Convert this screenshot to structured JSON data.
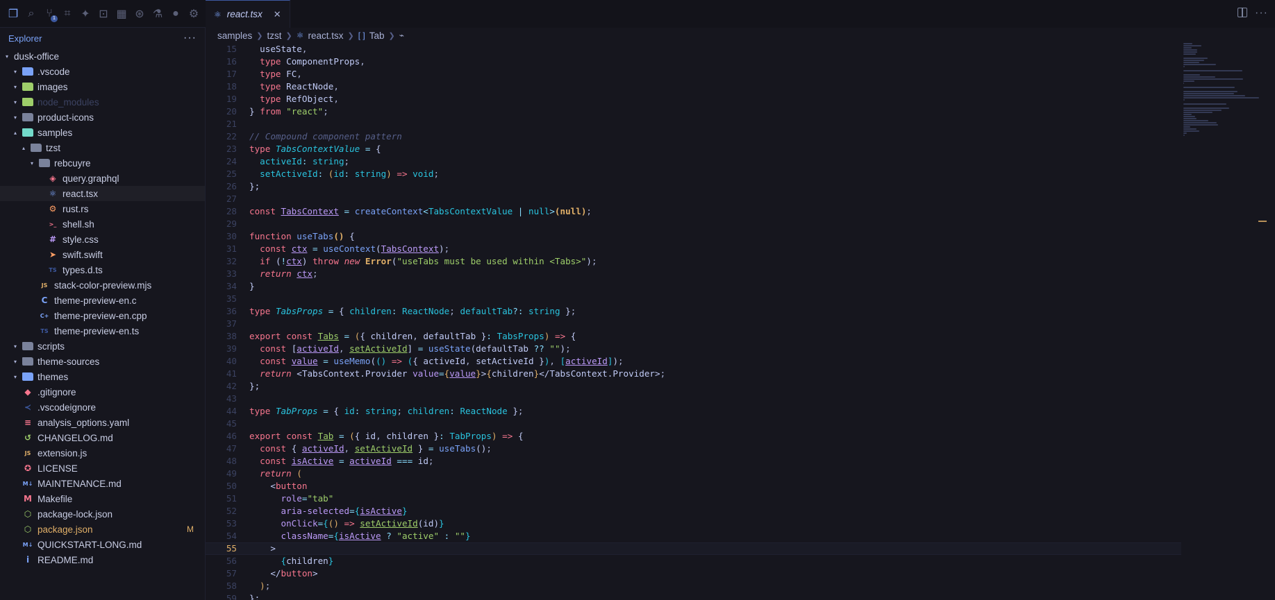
{
  "activity_bar": {
    "icons": [
      {
        "name": "files-icon",
        "glyph": "❐",
        "active": true
      },
      {
        "name": "search-icon",
        "glyph": "⌕"
      },
      {
        "name": "source-control-icon",
        "glyph": "⑂",
        "badge": "1"
      },
      {
        "name": "map-icon",
        "glyph": "⌗"
      },
      {
        "name": "extensions-icon",
        "glyph": "✦"
      },
      {
        "name": "remote-icon",
        "glyph": "⊡"
      },
      {
        "name": "grid-icon",
        "glyph": "▦"
      },
      {
        "name": "palette-icon",
        "glyph": "⊛"
      },
      {
        "name": "flask-icon",
        "glyph": "⚗"
      },
      {
        "name": "circle-icon",
        "glyph": "●"
      },
      {
        "name": "settings-icon",
        "glyph": "⚙"
      }
    ]
  },
  "sidebar": {
    "title": "Explorer",
    "more": "···",
    "root": "dusk-office",
    "items": [
      {
        "label": ".vscode",
        "depth": 1,
        "chev": "▾",
        "icon": "folder-icon",
        "color": "#7aa2f7",
        "glyph": "▰"
      },
      {
        "label": "images",
        "depth": 1,
        "chev": "▾",
        "icon": "folder-icon",
        "color": "#9ece6a",
        "glyph": "▰"
      },
      {
        "label": "node_modules",
        "depth": 1,
        "chev": "▾",
        "icon": "folder-icon",
        "color": "#9ece6a",
        "glyph": "▰",
        "dim": true
      },
      {
        "label": "product-icons",
        "depth": 1,
        "chev": "▾",
        "icon": "folder-icon",
        "color": "#7a829b",
        "glyph": "▰"
      },
      {
        "label": "samples",
        "depth": 1,
        "chev": "▴",
        "icon": "folder-icon",
        "color": "#73daca",
        "glyph": "▰"
      },
      {
        "label": "tzst",
        "depth": 2,
        "chev": "▴",
        "icon": "folder-icon",
        "color": "#7a829b",
        "glyph": "▰"
      },
      {
        "label": "rebcuyre",
        "depth": 3,
        "chev": "▾",
        "icon": "folder-icon",
        "color": "#7a829b",
        "glyph": "▰"
      },
      {
        "label": "query.graphql",
        "depth": 4,
        "icon": "graphql-icon",
        "color": "#f7768e",
        "glyph": "◈"
      },
      {
        "label": "react.tsx",
        "depth": 4,
        "icon": "react-icon",
        "color": "#7aa2f7",
        "glyph": "⚛",
        "selected": true
      },
      {
        "label": "rust.rs",
        "depth": 4,
        "icon": "rust-icon",
        "color": "#ff9e64",
        "glyph": "⚙"
      },
      {
        "label": "shell.sh",
        "depth": 4,
        "icon": "shell-icon",
        "color": "#f7768e",
        "glyph": ">_"
      },
      {
        "label": "style.css",
        "depth": 4,
        "icon": "css-icon",
        "color": "#bb9af7",
        "glyph": "#"
      },
      {
        "label": "swift.swift",
        "depth": 4,
        "icon": "swift-icon",
        "color": "#ff9e64",
        "glyph": "➤"
      },
      {
        "label": "types.d.ts",
        "depth": 4,
        "icon": "typescript-icon",
        "color": "#3d59a1",
        "glyph": "TS"
      },
      {
        "label": "stack-color-preview.mjs",
        "depth": 3,
        "icon": "javascript-icon",
        "color": "#e0af68",
        "glyph": "JS"
      },
      {
        "label": "theme-preview-en.c",
        "depth": 3,
        "icon": "c-icon",
        "color": "#7aa2f7",
        "glyph": "C"
      },
      {
        "label": "theme-preview-en.cpp",
        "depth": 3,
        "icon": "cpp-icon",
        "color": "#7aa2f7",
        "glyph": "C+"
      },
      {
        "label": "theme-preview-en.ts",
        "depth": 3,
        "icon": "typescript-icon",
        "color": "#3d59a1",
        "glyph": "TS"
      },
      {
        "label": "scripts",
        "depth": 1,
        "chev": "▾",
        "icon": "folder-icon",
        "color": "#7a829b",
        "glyph": "▰"
      },
      {
        "label": "theme-sources",
        "depth": 1,
        "chev": "▾",
        "icon": "folder-icon",
        "color": "#7a829b",
        "glyph": "▰"
      },
      {
        "label": "themes",
        "depth": 1,
        "chev": "▾",
        "icon": "folder-icon",
        "color": "#7aa2f7",
        "glyph": "▰"
      },
      {
        "label": ".gitignore",
        "depth": 1,
        "icon": "git-icon",
        "color": "#f7768e",
        "glyph": "◆"
      },
      {
        "label": ".vscodeignore",
        "depth": 1,
        "icon": "vscode-icon",
        "color": "#3d59a1",
        "glyph": "≺"
      },
      {
        "label": "analysis_options.yaml",
        "depth": 1,
        "icon": "yaml-icon",
        "color": "#f7768e",
        "glyph": "≡"
      },
      {
        "label": "CHANGELOG.md",
        "depth": 1,
        "icon": "changelog-icon",
        "color": "#9ece6a",
        "glyph": "↺"
      },
      {
        "label": "extension.js",
        "depth": 1,
        "icon": "javascript-icon",
        "color": "#e0af68",
        "glyph": "JS"
      },
      {
        "label": "LICENSE",
        "depth": 1,
        "icon": "license-icon",
        "color": "#f7768e",
        "glyph": "✪"
      },
      {
        "label": "MAINTENANCE.md",
        "depth": 1,
        "icon": "markdown-icon",
        "color": "#7aa2f7",
        "glyph": "M↓"
      },
      {
        "label": "Makefile",
        "depth": 1,
        "icon": "makefile-icon",
        "color": "#f7768e",
        "glyph": "M"
      },
      {
        "label": "package-lock.json",
        "depth": 1,
        "icon": "npm-icon",
        "color": "#9ece6a",
        "glyph": "⬡"
      },
      {
        "label": "package.json",
        "depth": 1,
        "icon": "npm-icon",
        "color": "#9ece6a",
        "glyph": "⬡",
        "modified": true,
        "deco": "M"
      },
      {
        "label": "QUICKSTART-LONG.md",
        "depth": 1,
        "icon": "markdown-icon",
        "color": "#7aa2f7",
        "glyph": "M↓"
      },
      {
        "label": "README.md",
        "depth": 1,
        "icon": "info-icon",
        "color": "#7aa2f7",
        "glyph": "i"
      }
    ]
  },
  "tabs": [
    {
      "label": "react.tsx",
      "close": "✕"
    }
  ],
  "breadcrumb": [
    "samples",
    "tzst",
    "react.tsx",
    "Tab"
  ],
  "editor": {
    "current_line": 55,
    "lines": [
      {
        "n": 15,
        "html": "  <span class='var'>useState</span>,"
      },
      {
        "n": 16,
        "html": "  <span class='kw2'>type</span> <span class='var'>ComponentProps</span>,"
      },
      {
        "n": 17,
        "html": "  <span class='kw2'>type</span> <span class='var'>FC</span>,"
      },
      {
        "n": 18,
        "html": "  <span class='kw2'>type</span> <span class='var'>ReactNode</span>,"
      },
      {
        "n": 19,
        "html": "  <span class='kw2'>type</span> <span class='var'>RefObject</span>,"
      },
      {
        "n": 20,
        "html": "<span class='var'>}</span> <span class='kw2'>from</span> <span class='str'>\"react\"</span>;"
      },
      {
        "n": 21,
        "html": ""
      },
      {
        "n": 22,
        "html": "<span class='cm'>// Compound component pattern</span>"
      },
      {
        "n": 23,
        "html": "<span class='kw2'>type</span> <span class='ty it'>TabsContextValue</span> <span class='pun'>=</span> <span class='var'>{</span>"
      },
      {
        "n": 24,
        "html": "  <span class='ty'>activeId</span><span class='pun'>:</span> <span class='ty'>string</span>;"
      },
      {
        "n": 25,
        "html": "  <span class='ty'>setActiveId</span><span class='pun'>:</span> <span class='bold' style='font-weight:normal'>(</span><span class='ty'>id</span><span class='pun'>:</span> <span class='ty'>string</span><span class='bold' style='font-weight:normal'>)</span> <span class='kw2'>=&gt;</span> <span class='ty'>void</span>;"
      },
      {
        "n": 26,
        "html": "<span class='var'>};</span>"
      },
      {
        "n": 27,
        "html": ""
      },
      {
        "n": 28,
        "html": "<span class='kw2'>const</span> <span class='ul' style='color:#bb9af7'>TabsContext</span> <span class='pun'>=</span> <span class='fn'>createContext</span><span class='pun'>&lt;</span><span class='ty'>TabsContextValue</span> <span class='pun'>|</span> <span class='ty'>null</span><span class='pun'>&gt;</span><span class='bold'>(null)</span>;"
      },
      {
        "n": 29,
        "html": ""
      },
      {
        "n": 30,
        "html": "<span class='kw2'>function</span> <span class='fn'>useTabs</span><span class='bold'>()</span> <span class='var'>{</span>"
      },
      {
        "n": 31,
        "html": "  <span class='kw2'>const</span> <span class='ul' style='color:#bb9af7'>ctx</span> <span class='pun'>=</span> <span class='fn'>useContext</span><span class='var'>(</span><span class='ul' style='color:#bb9af7'>TabsContext</span><span class='var'>)</span>;"
      },
      {
        "n": 32,
        "html": "  <span class='kw2'>if</span> <span class='var'>(</span><span class='pun'>!</span><span class='ul' style='color:#bb9af7'>ctx</span><span class='var'>)</span> <span class='kw2'>throw</span> <span class='kw2 it'>new</span> <span class='bold'>Error</span><span class='var'>(</span><span class='str'>\"useTabs must be used within &lt;Tabs&gt;\"</span><span class='var'>)</span>;"
      },
      {
        "n": 33,
        "html": "  <span class='kw2 it'>return</span> <span class='ul' style='color:#bb9af7'>ctx</span>;"
      },
      {
        "n": 34,
        "html": "<span class='var'>}</span>"
      },
      {
        "n": 35,
        "html": ""
      },
      {
        "n": 36,
        "html": "<span class='kw2'>type</span> <span class='ty it'>TabsProps</span> <span class='pun'>=</span> <span class='var'>{</span> <span class='ty'>children</span><span class='pun'>:</span> <span class='ty'>ReactNode</span>; <span class='ty'>defaultTab</span><span class='pun'>?:</span> <span class='ty'>string</span> <span class='var'>}</span>;"
      },
      {
        "n": 37,
        "html": ""
      },
      {
        "n": 38,
        "html": "<span class='kw2'>export</span> <span class='kw2'>const</span> <span class='ul' style='color:#9ece6a'>Tabs</span> <span class='pun'>=</span> <span class='bold' style='font-weight:normal'>(</span><span class='var'>{</span> <span class='var'>children</span>, <span class='var'>defaultTab</span> <span class='var'>}</span><span class='pun'>:</span> <span class='ty'>TabsProps</span><span class='bold' style='font-weight:normal'>)</span> <span class='kw2'>=&gt;</span> <span class='var'>{</span>"
      },
      {
        "n": 39,
        "html": "  <span class='kw2'>const</span> <span class='var'>[</span><span class='ul' style='color:#bb9af7'>activeId</span>, <span class='ul' style='color:#9ece6a'>setActiveId</span><span class='var'>]</span> <span class='pun'>=</span> <span class='fn'>useState</span><span class='var'>(</span><span class='var'>defaultTab</span> <span class='pun'>??</span> <span class='str'>\"\"</span><span class='var'>)</span>;"
      },
      {
        "n": 40,
        "html": "  <span class='kw2'>const</span> <span class='ul' style='color:#bb9af7'>value</span> <span class='pun'>=</span> <span class='fn'>useMemo</span><span class='var'>(</span><span class='ty'>()</span> <span class='kw2'>=&gt;</span> <span class='ty'>(</span><span class='var'>{</span> <span class='var'>activeId</span>, <span class='var'>setActiveId</span> <span class='var'>}</span><span class='ty'>)</span>, <span class='ty'>[</span><span class='ul' style='color:#bb9af7'>activeId</span><span class='ty'>]</span><span class='var'>)</span>;"
      },
      {
        "n": 41,
        "html": "  <span class='kw2 it'>return</span> <span class='var'>&lt;</span><span class='var'>TabsContext.Provider</span> <span class='attr'>value</span><span class='pun'>=</span><span class='bold' style='font-weight:normal'>{</span><span class='ul' style='color:#bb9af7'>value</span><span class='bold' style='font-weight:normal'>}</span><span class='var'>&gt;</span><span class='bold' style='font-weight:normal'>{</span><span class='var'>children</span><span class='bold' style='font-weight:normal'>}</span><span class='var'>&lt;/</span><span class='var'>TabsContext.Provider</span><span class='var'>&gt;</span>;"
      },
      {
        "n": 42,
        "html": "<span class='var'>};</span>"
      },
      {
        "n": 43,
        "html": ""
      },
      {
        "n": 44,
        "html": "<span class='kw2'>type</span> <span class='ty it'>TabProps</span> <span class='pun'>=</span> <span class='var'>{</span> <span class='ty'>id</span><span class='pun'>:</span> <span class='ty'>string</span>; <span class='ty'>children</span><span class='pun'>:</span> <span class='ty'>ReactNode</span> <span class='var'>}</span>;"
      },
      {
        "n": 45,
        "html": ""
      },
      {
        "n": 46,
        "html": "<span class='kw2'>export</span> <span class='kw2'>const</span> <span class='ul' style='color:#9ece6a'>Tab</span> <span class='pun'>=</span> <span class='bold' style='font-weight:normal'>(</span><span class='var'>{</span> <span class='var'>id</span>, <span class='var'>children</span> <span class='var'>}</span><span class='pun'>:</span> <span class='ty'>TabProps</span><span class='bold' style='font-weight:normal'>)</span> <span class='kw2'>=&gt;</span> <span class='var'>{</span>"
      },
      {
        "n": 47,
        "html": "  <span class='kw2'>const</span> <span class='var'>{</span> <span class='ul' style='color:#bb9af7'>activeId</span>, <span class='ul' style='color:#9ece6a'>setActiveId</span> <span class='var'>}</span> <span class='pun'>=</span> <span class='fn'>useTabs</span><span class='var'>()</span>;"
      },
      {
        "n": 48,
        "html": "  <span class='kw2'>const</span> <span class='ul' style='color:#bb9af7'>isActive</span> <span class='pun'>=</span> <span class='ul' style='color:#bb9af7'>activeId</span> <span class='pun'>===</span> <span class='var'>id</span>;"
      },
      {
        "n": 49,
        "html": "  <span class='kw2 it'>return</span> <span class='bold' style='font-weight:normal'>(</span>"
      },
      {
        "n": 50,
        "html": "    <span class='var'>&lt;</span><span class='tag'>button</span>"
      },
      {
        "n": 51,
        "html": "      <span class='attr'>role</span><span class='pun'>=</span><span class='str'>\"tab\"</span>"
      },
      {
        "n": 52,
        "html": "      <span class='attr'>aria-selected</span><span class='pun'>=</span><span class='ty'>{</span><span class='ul' style='color:#bb9af7'>isActive</span><span class='ty'>}</span>"
      },
      {
        "n": 53,
        "html": "      <span class='attr'>onClick</span><span class='pun'>=</span><span class='ty'>{</span><span class='bold' style='font-weight:normal'>()</span> <span class='kw2'>=&gt;</span> <span class='ul' style='color:#9ece6a'>setActiveId</span><span class='var'>(id)</span><span class='ty'>}</span>"
      },
      {
        "n": 54,
        "html": "      <span class='attr'>className</span><span class='pun'>=</span><span class='ty'>{</span><span class='ul' style='color:#bb9af7'>isActive</span> <span class='pun'>?</span> <span class='str'>\"active\"</span> <span class='pun'>:</span> <span class='str'>\"\"</span><span class='ty'>}</span>"
      },
      {
        "n": 55,
        "html": "    <span class='var'>&gt;</span>"
      },
      {
        "n": 56,
        "html": "      <span class='ty'>{</span><span class='var'>children</span><span class='ty'>}</span>"
      },
      {
        "n": 57,
        "html": "    <span class='var'>&lt;/</span><span class='tag'>button</span><span class='var'>&gt;</span>"
      },
      {
        "n": 58,
        "html": "  <span class='bold' style='font-weight:normal'>)</span>;"
      },
      {
        "n": 59,
        "html": "<span class='var'>};</span>"
      }
    ]
  }
}
